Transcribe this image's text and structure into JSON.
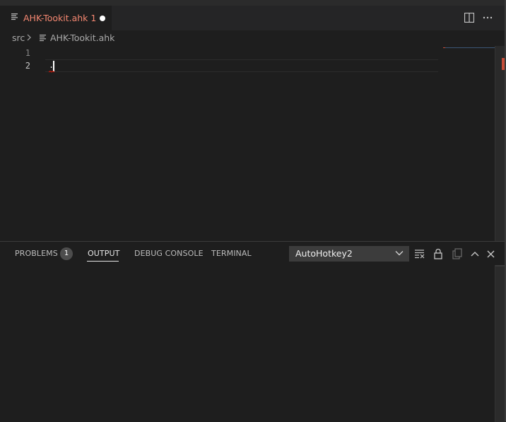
{
  "tab": {
    "title": "AHK-Tookit.ahk 1",
    "icon": "file-lines-icon",
    "modified_indicator": "dirty-dot",
    "color": "#f48771"
  },
  "editor_actions": [
    "split-editor-icon",
    "more-actions-icon"
  ],
  "breadcrumb": {
    "folder": "src",
    "file": "AHK-Tookit.ahk"
  },
  "editor": {
    "line_numbers": [
      "1",
      "2"
    ],
    "lines": [
      "",
      "."
    ],
    "active_line": 2
  },
  "panel": {
    "tabs": [
      {
        "label": "PROBLEMS"
      },
      {
        "label": "OUTPUT",
        "active": true
      },
      {
        "label": "DEBUG CONSOLE"
      },
      {
        "label": "TERMINAL"
      }
    ],
    "problems_count": "1",
    "output_channel": "AutoHotkey2",
    "actions": [
      "clear-output-icon",
      "lock-scroll-icon",
      "open-log-icon",
      "maximize-panel-icon",
      "close-panel-icon"
    ]
  },
  "colors": {
    "background": "#1e1e1e",
    "error": "#c74e39",
    "tab_modified_text": "#f48771"
  }
}
